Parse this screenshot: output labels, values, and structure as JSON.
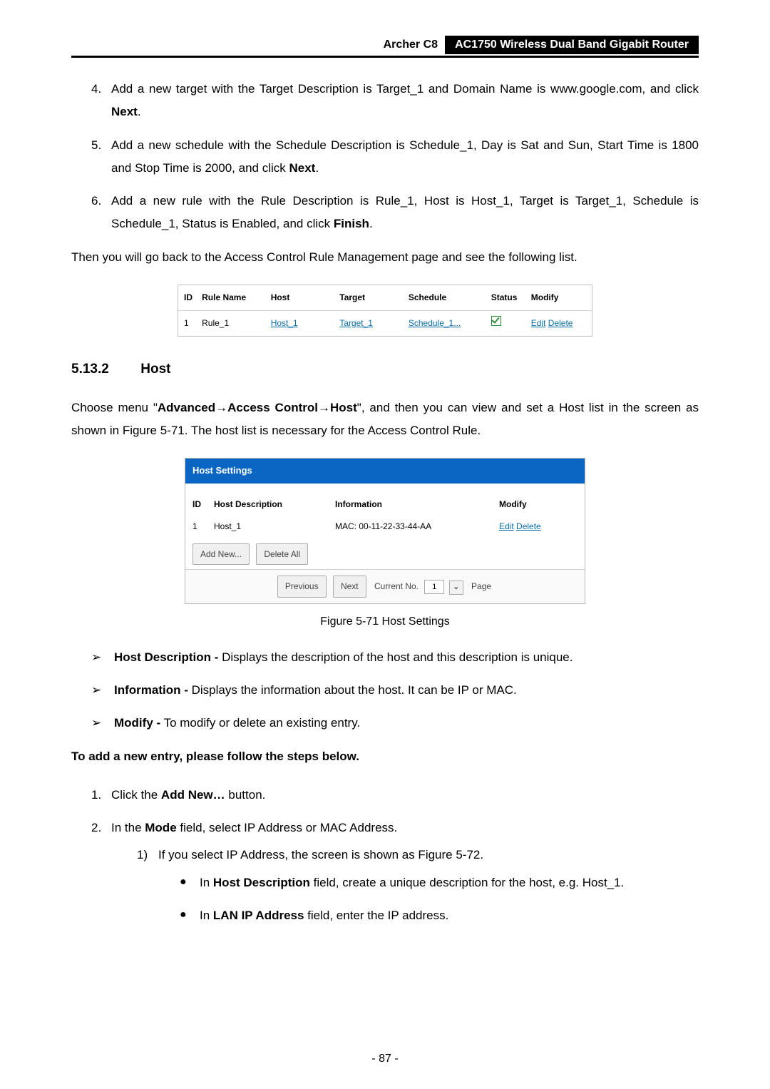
{
  "header": {
    "model": "Archer C8",
    "title": "AC1750 Wireless Dual Band Gigabit Router"
  },
  "steps_first": [
    {
      "num": "4.",
      "pre": "Add a new target with the Target Description is Target_1 and Domain Name is www.google.com, and click ",
      "bold": "Next",
      "post": "."
    },
    {
      "num": "5.",
      "pre": "Add a new schedule with the Schedule Description is Schedule_1, Day is Sat and Sun, Start Time is 1800 and Stop Time is 2000, and click ",
      "bold": "Next",
      "post": "."
    },
    {
      "num": "6.",
      "pre": "Add a new rule with the Rule Description is Rule_1, Host is Host_1, Target is Target_1, Schedule is Schedule_1, Status is Enabled, and click ",
      "bold": "Finish",
      "post": "."
    }
  ],
  "then_line": "Then you will go back to the Access Control Rule Management page and see the following list.",
  "rule_table": {
    "headers": {
      "id": "ID",
      "name": "Rule Name",
      "host": "Host",
      "target": "Target",
      "schedule": "Schedule",
      "status": "Status",
      "modify": "Modify"
    },
    "row": {
      "id": "1",
      "name": "Rule_1",
      "host": "Host_1",
      "target": "Target_1",
      "schedule": "Schedule_1...",
      "edit": "Edit",
      "delete": "Delete"
    }
  },
  "section": {
    "num": "5.13.2",
    "title": "Host"
  },
  "host_intro": {
    "p1": "Choose menu \"",
    "b1": "Advanced",
    "arrow1": "→",
    "b2": "Access Control",
    "arrow2": "→",
    "b3": "Host",
    "p2": "\", and then you can view and set a Host list in the screen as shown in Figure 5-71. The host list is necessary for the Access Control Rule."
  },
  "host_settings": {
    "title": "Host Settings",
    "headers": {
      "id": "ID",
      "desc": "Host Description",
      "info": "Information",
      "modify": "Modify"
    },
    "row": {
      "id": "1",
      "desc": "Host_1",
      "info": "MAC: 00-11-22-33-44-AA",
      "edit": "Edit",
      "delete": "Delete"
    },
    "buttons": {
      "add": "Add New...",
      "del": "Delete All",
      "prev": "Previous",
      "next": "Next",
      "cur_label": "Current No.",
      "cur_val": "1",
      "drop": "⌄",
      "page": "Page"
    }
  },
  "fig_caption": "Figure 5-71 Host Settings",
  "arrow_items": [
    {
      "b": "Host Description -",
      "t": " Displays the description of the host and this description is unique."
    },
    {
      "b": "Information -",
      "t": " Displays the information about the host. It can be IP or MAC."
    },
    {
      "b": "Modify -",
      "t": " To modify or delete an existing entry."
    }
  ],
  "add_heading": "To add a new entry, please follow the steps below.",
  "steps_second": [
    {
      "num": "1.",
      "pre": "Click the ",
      "bold": "Add New…",
      "post": " button."
    },
    {
      "num": "2.",
      "pre": "In the ",
      "bold": "Mode",
      "post": " field, select IP Address or MAC Address."
    }
  ],
  "sub_step": {
    "snum": "1)",
    "text": "If you select IP Address, the screen is shown as Figure 5-72."
  },
  "bullets": [
    {
      "pre": "In ",
      "bold": "Host Description",
      "post": " field, create a unique description for the host, e.g. Host_1."
    },
    {
      "pre": "In ",
      "bold": "LAN IP Address",
      "post": " field, enter the IP address."
    }
  ],
  "page_num": "- 87 -"
}
